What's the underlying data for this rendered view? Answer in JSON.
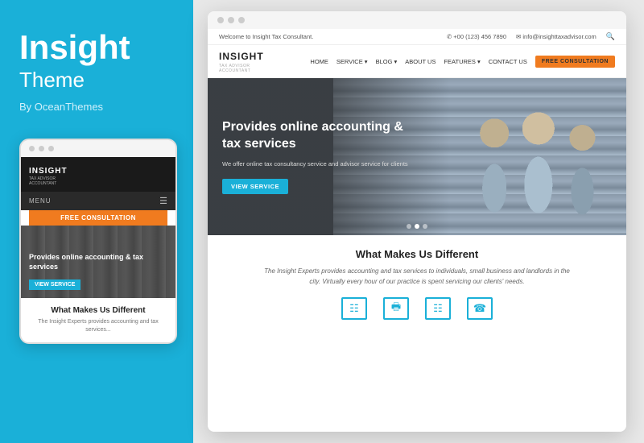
{
  "left": {
    "title": "Insight",
    "subtitle": "Theme",
    "by": "By OceanThemes"
  },
  "mobile": {
    "logo": "INSIGHT",
    "logo_sub": "TAX ADVISOR\nACCOUNTANT",
    "menu_label": "MENU",
    "btn_label": "FREE CONSULTATION",
    "hero_title": "Provides online accounting & tax services",
    "view_service": "VIEW SERVICE",
    "bottom_title": "What Makes Us Different",
    "bottom_text": "The Insight Experts provides accounting and tax services..."
  },
  "desktop": {
    "topbar_welcome": "Welcome to Insight Tax Consultant.",
    "topbar_phone": "✆ +00 (123) 456 7890",
    "topbar_email": "✉ info@insighttaxadvisor.com",
    "logo": "INSIGHT",
    "logo_sub": "TAX ADVISOR\nACCOUNTANT",
    "nav_items": [
      "HOME",
      "SERVICE ▾",
      "BLOG ▾",
      "ABOUT US",
      "FEATURES ▾",
      "CONTACT US"
    ],
    "cta": "FREE CONSULTATION",
    "hero_title": "Provides online accounting & tax services",
    "hero_desc": "We offer online tax consultancy service and advisor service for clients",
    "hero_btn": "VIEW SERVICE",
    "section_title": "What Makes Us Different",
    "section_text": "The Insight Experts provides accounting and tax services to individuals, small business and landlords in the city. Virtually every hour of our practice is spent servicing our clients' needs.",
    "icons": [
      {
        "symbol": "▤",
        "name": "accounting-icon"
      },
      {
        "symbol": "⎙",
        "name": "print-icon"
      },
      {
        "symbol": "⊡",
        "name": "tax-icon"
      },
      {
        "symbol": "☎",
        "name": "contact-icon"
      }
    ]
  },
  "colors": {
    "brand_blue": "#1ab0d8",
    "orange": "#f07b1f",
    "dark": "#1a1a1a"
  }
}
